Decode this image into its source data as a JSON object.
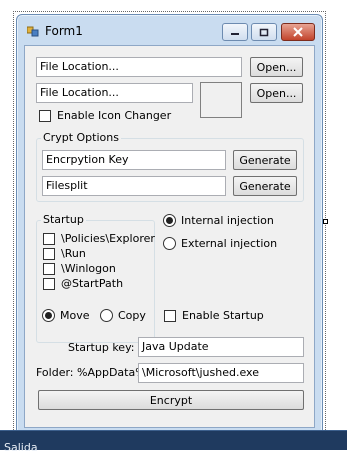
{
  "window": {
    "title": "Form1",
    "icon": "form-app-icon",
    "caption_buttons": [
      "minimize-icon",
      "maximize-icon",
      "close-icon"
    ]
  },
  "file1": {
    "value": "File Location...",
    "button": "Open..."
  },
  "file2": {
    "value": "File Location...",
    "button": "Open..."
  },
  "icon_changer": {
    "label": "Enable Icon Changer",
    "checked": false
  },
  "crypt_options": {
    "title": "Crypt Options",
    "key_value": "Encrpytion Key",
    "key_button": "Generate",
    "split_value": "Filesplit",
    "split_button": "Generate"
  },
  "startup": {
    "title": "Startup",
    "items": [
      {
        "label": "\\Policies\\Explorer",
        "checked": false
      },
      {
        "label": "\\Run",
        "checked": false
      },
      {
        "label": "\\Winlogon",
        "checked": false
      },
      {
        "label": "@StartPath",
        "checked": false
      }
    ],
    "move_label": "Move",
    "copy_label": "Copy",
    "selected_mode": "Move"
  },
  "injection": {
    "internal_label": "Internal injection",
    "external_label": "External injection",
    "selected": "Internal injection"
  },
  "enable_startup": {
    "label": "Enable Startup",
    "checked": false
  },
  "startup_key": {
    "label": "Startup key:",
    "value": "Java Update"
  },
  "folder": {
    "label": "Folder: %AppData%",
    "value": "\\Microsoft\\jushed.exe"
  },
  "encrypt_button": "Encrypt",
  "taskbar": {
    "label": "Salida"
  }
}
